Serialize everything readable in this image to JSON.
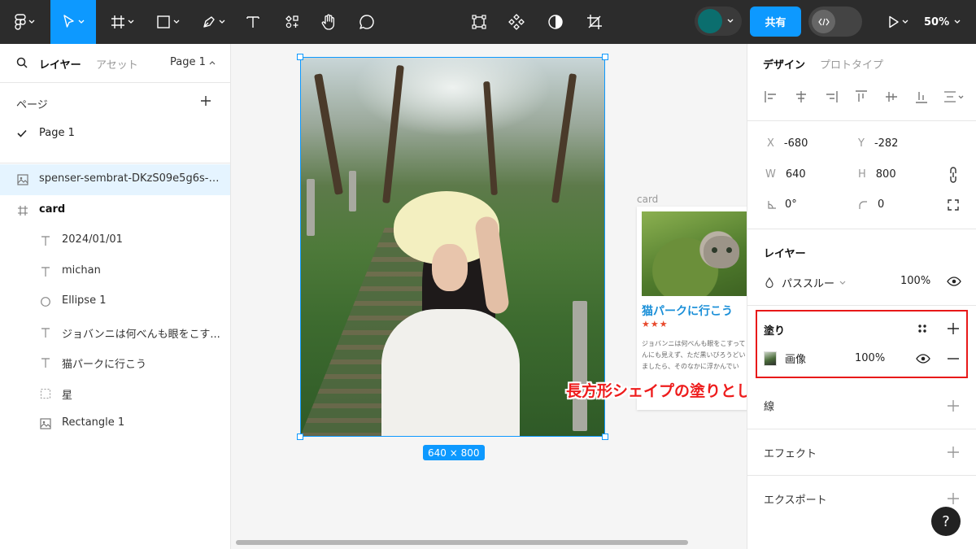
{
  "toolbar": {
    "tools": [
      "main-menu",
      "move",
      "frame",
      "shape",
      "pen",
      "text",
      "resources",
      "hand",
      "comment"
    ],
    "center_tools": [
      "component-set",
      "components",
      "mask",
      "crop"
    ],
    "share_label": "共有",
    "zoom_label": "50%",
    "accent": "#0d99ff"
  },
  "left_panel": {
    "tab_layers": "レイヤー",
    "tab_assets": "アセット",
    "page_selector": "Page 1",
    "pages_header": "ページ",
    "current_page": "Page 1",
    "layers": [
      {
        "name": "spenser-sembrat-DKzS09e5g6s-u...",
        "icon": "image-icon",
        "level": 0,
        "selected": true,
        "bold": false
      },
      {
        "name": "card",
        "icon": "frame-icon",
        "level": 0,
        "selected": false,
        "bold": true
      },
      {
        "name": "2024/01/01",
        "icon": "text-icon",
        "level": 1,
        "selected": false,
        "bold": false
      },
      {
        "name": "michan",
        "icon": "text-icon",
        "level": 1,
        "selected": false,
        "bold": false
      },
      {
        "name": "Ellipse 1",
        "icon": "ellipse-icon",
        "level": 1,
        "selected": false,
        "bold": false
      },
      {
        "name": "ジョバンニは何べんも眼をこす...",
        "icon": "text-icon",
        "level": 1,
        "selected": false,
        "bold": false
      },
      {
        "name": "猫パークに行こう",
        "icon": "text-icon",
        "level": 1,
        "selected": false,
        "bold": false
      },
      {
        "name": "星",
        "icon": "group-icon",
        "level": 1,
        "selected": false,
        "bold": false
      },
      {
        "name": "Rectangle 1",
        "icon": "image-icon",
        "level": 1,
        "selected": false,
        "bold": false
      }
    ]
  },
  "canvas": {
    "size_badge": "640 × 800",
    "card_label": "card",
    "card": {
      "title": "猫パークに行こう",
      "stars": "★★★",
      "body": "ジョバンニは何べんも眼をこすってんにも見えず、ただ黒いびろうどいましたら、そのなかに浮かんでい"
    },
    "callout": "長方形シェイプの塗りとして、画像が設定される",
    "callout_color": "#ee1c1c"
  },
  "right_panel": {
    "tab_design": "デザイン",
    "tab_prototype": "プロトタイプ",
    "x_label": "X",
    "x_value": "-680",
    "y_label": "Y",
    "y_value": "-282",
    "w_label": "W",
    "w_value": "640",
    "h_label": "H",
    "h_value": "800",
    "rotation_value": "0°",
    "radius_value": "0",
    "layer_title": "レイヤー",
    "blend_mode": "パススルー",
    "layer_opacity": "100%",
    "fill_title": "塗り",
    "fill_type": "画像",
    "fill_opacity": "100%",
    "stroke_title": "線",
    "effects_title": "エフェクト",
    "export_title": "エクスポート",
    "help_label": "?",
    "highlight_color": "#e81919"
  }
}
